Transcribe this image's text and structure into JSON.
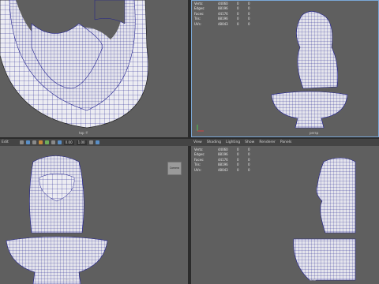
{
  "views": {
    "top_left": {
      "caption": "top -Y"
    },
    "top_right": {
      "caption": "persp"
    },
    "bottom_left": {
      "caption": "front -Z"
    },
    "bottom_right": {
      "caption": "side"
    }
  },
  "hud": {
    "rows": [
      {
        "label": "Verts:",
        "value": "44060",
        "c1": "0",
        "c2": "0"
      },
      {
        "label": "Edges:",
        "value": "88196",
        "c1": "0",
        "c2": "0"
      },
      {
        "label": "Faces:",
        "value": "44176",
        "c1": "0",
        "c2": "0"
      },
      {
        "label": "Tris:",
        "value": "88196",
        "c1": "0",
        "c2": "0"
      },
      {
        "label": "UVs:",
        "value": "48043",
        "c1": "0",
        "c2": "0"
      }
    ]
  },
  "menu": {
    "left": [
      "Edit"
    ],
    "right": [
      "View",
      "Shading",
      "Lighting",
      "Show",
      "Renderer",
      "Panels"
    ]
  },
  "toolbar": {
    "field1": "0.00",
    "field2": "1.00"
  },
  "camera_button": {
    "label": "Camera"
  },
  "colors": {
    "viewport": "#5f5f5f",
    "wire": "#1a1a8c",
    "surface": "#e8e8ef",
    "menubar": "#444444"
  }
}
